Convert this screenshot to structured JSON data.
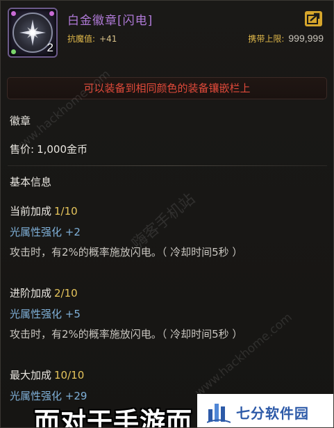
{
  "item": {
    "name": "白金徽章[闪电]",
    "stack_count": "2",
    "stat_label": "抗魔值:",
    "stat_value": "+41",
    "carry_label": "携带上限:",
    "carry_value": "999,999",
    "icon": "star-badge-icon"
  },
  "banner": {
    "text": "可以装备到相同颜色的装备镶嵌栏上"
  },
  "category": "徽章",
  "price": {
    "label": "售价:",
    "value": "1,000金币"
  },
  "basic_info_header": "基本信息",
  "tiers": [
    {
      "label": "当前加成",
      "level": "1/10",
      "attr": "光属性强化 +2",
      "effect": "攻击时，有2%的概率施放闪电。（ 冷却时间5秒 ）"
    },
    {
      "label": "进阶加成",
      "level": "2/10",
      "attr": "光属性强化 +5",
      "effect": "攻击时，有2%的概率施放闪电。（ 冷却时间5秒 ）"
    },
    {
      "label": "最大加成",
      "level": "10/10",
      "attr": "光属性强化 +29"
    }
  ],
  "caption": "而对于手游而",
  "watermarks": {
    "url1": "www.hackhome.com",
    "site": "嗨客手机站",
    "url2": "www.hackhome.com"
  },
  "logo": {
    "text": "七分软件园",
    "icon": "bar-chart-logo-icon"
  },
  "colors": {
    "title": "#b07ad8",
    "stat_label": "#e0b84a",
    "warning": "#e04a3a",
    "tier_level": "#e6c55c",
    "attribute": "#7fb0d8",
    "export_button": "#d6a62c"
  }
}
